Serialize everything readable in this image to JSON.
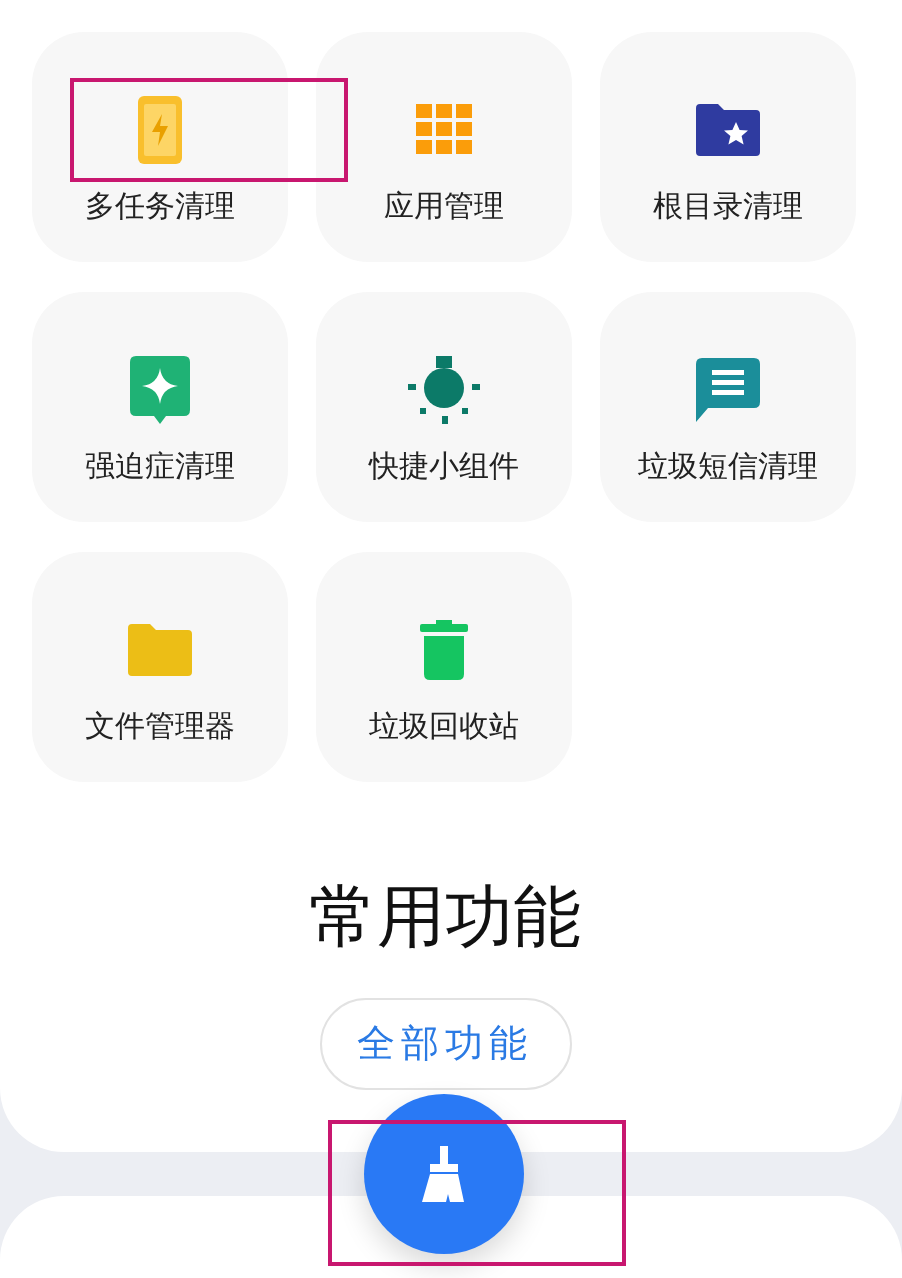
{
  "tiles": [
    {
      "label": "多任务清理",
      "highlighted": true
    },
    {
      "label": "应用管理",
      "highlighted": false
    },
    {
      "label": "根目录清理",
      "highlighted": false
    },
    {
      "label": "强迫症清理",
      "highlighted": false
    },
    {
      "label": "快捷小组件",
      "highlighted": false
    },
    {
      "label": "垃圾短信清理",
      "highlighted": false
    },
    {
      "label": "文件管理器",
      "highlighted": false
    },
    {
      "label": "垃圾回收站",
      "highlighted": false
    }
  ],
  "section_title": "常用功能",
  "all_button": {
    "label": "全部功能"
  },
  "clean_button": {
    "highlighted": true
  }
}
